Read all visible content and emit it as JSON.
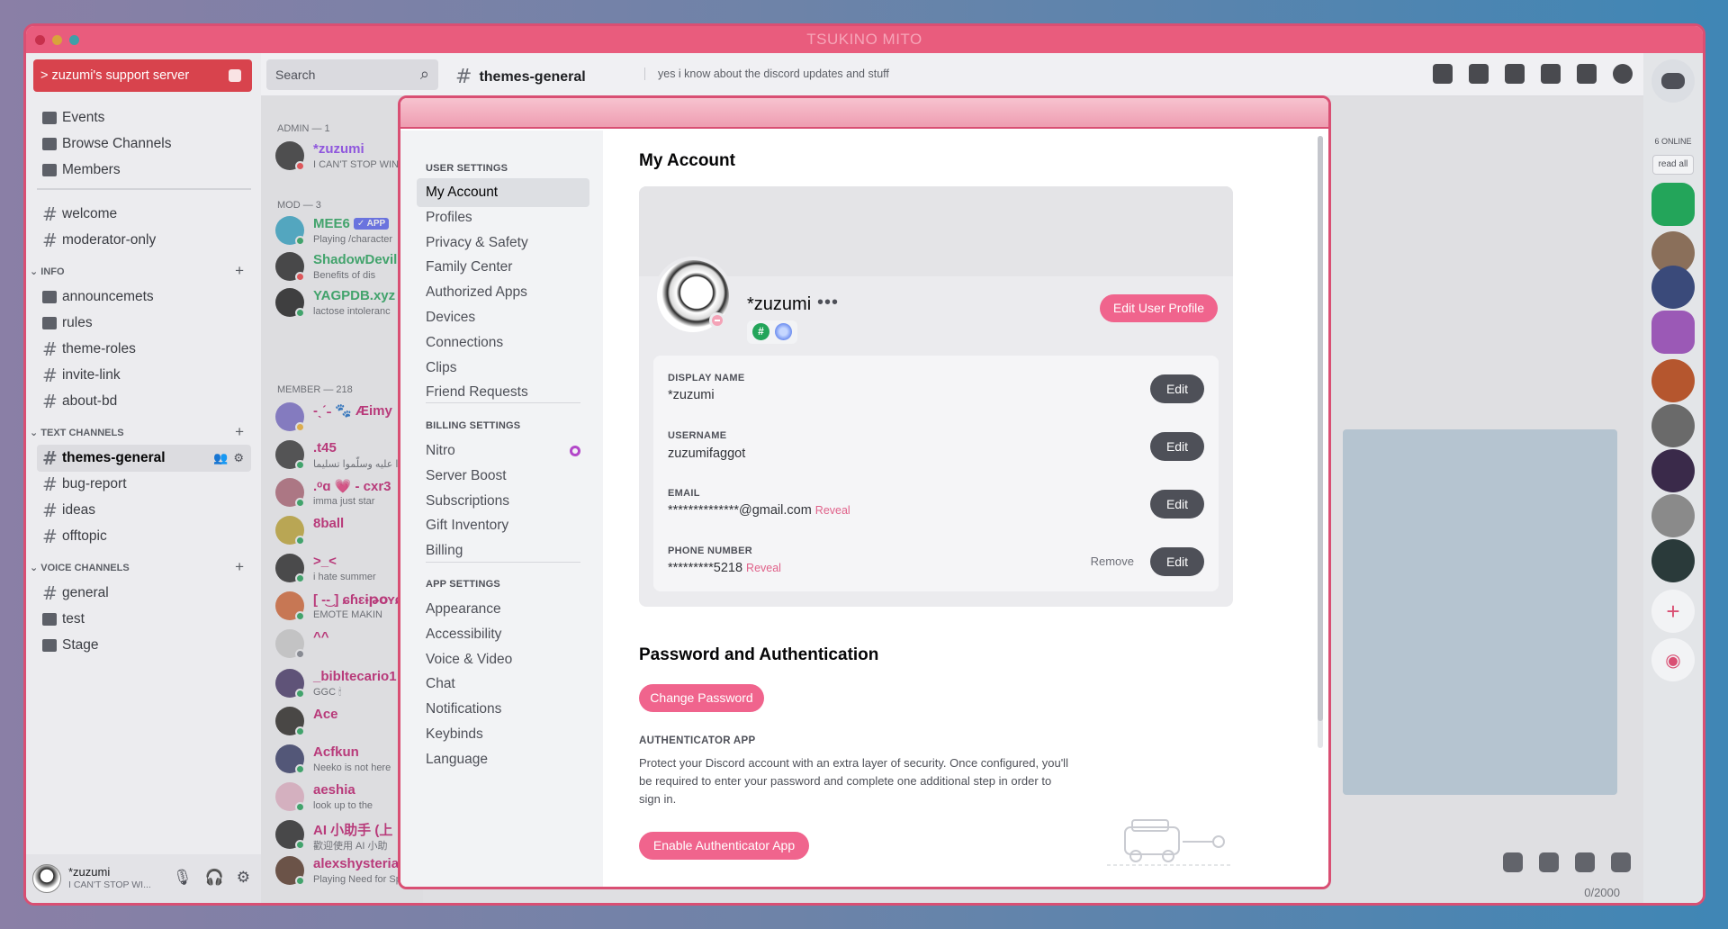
{
  "window": {
    "title": "TSUKINO MITO",
    "accent": "#e95c7d"
  },
  "server": {
    "name": "> zuzumi's support server",
    "nav": [
      {
        "label": "Events",
        "icon": "calendar-icon"
      },
      {
        "label": "Browse Channels",
        "icon": "browse-icon"
      },
      {
        "label": "Members",
        "icon": "members-icon"
      }
    ],
    "channels_top": [
      "welcome",
      "moderator-only"
    ],
    "info_category": "INFO",
    "info_channels": [
      {
        "label": "announcemets",
        "icon": "megaphone-icon"
      },
      {
        "label": "rules",
        "icon": "rules-icon"
      },
      {
        "label": "theme-roles",
        "icon": "hash-icon"
      },
      {
        "label": "invite-link",
        "icon": "hash-icon"
      },
      {
        "label": "about-bd",
        "icon": "hash-icon"
      }
    ],
    "text_category": "TEXT CHANNELS",
    "text_channels": [
      "themes-general",
      "bug-report",
      "ideas",
      "offtopic"
    ],
    "voice_category": "VOICE CHANNELS",
    "voice_channels": [
      "general",
      "test",
      "Stage"
    ]
  },
  "user_panel": {
    "name": "*zuzumi",
    "status": "I CAN'T STOP WI..."
  },
  "topbar": {
    "search_placeholder": "Search",
    "channel": "themes-general",
    "topic": "yes i know about the discord updates and stuff"
  },
  "members": {
    "admin_header": "ADMIN — 1",
    "mod_header": "MOD — 3",
    "member_header": "MEMBER — 218",
    "list": [
      {
        "name": "*zuzumi",
        "status": "I CAN'T STOP WIN",
        "color": "#8a3ff0",
        "avatar": "#333333",
        "dot": "#f23f43"
      },
      {
        "name": "MEE6",
        "status": "Playing /character",
        "color": "#23a55a",
        "avatar": "#3aa8c9",
        "dot": "#23a55a",
        "badge": "✓ APP"
      },
      {
        "name": "ShadowDevil",
        "status": "Benefits of dis",
        "color": "#23a55a",
        "avatar": "#2b2b2b",
        "dot": "#f23f43"
      },
      {
        "name": "YAGPDB.xyz",
        "status": "lactose intoleranc",
        "color": "#23a55a",
        "avatar": "#1f1f1f",
        "dot": "#23a55a"
      },
      {
        "name": "-ˎˊ˗ 🐾 Æimy",
        "status": "",
        "color": "#c0186c",
        "avatar": "#7b6fc9",
        "dot": "#f0b232"
      },
      {
        "name": ".t45",
        "status": "صلّوا عليه وسلّموا تسليما",
        "color": "#c0186c",
        "avatar": "#3b3b3b",
        "dot": "#23a55a"
      },
      {
        "name": ".ᵒɑ 💗 - cxr3",
        "status": "imma just star",
        "color": "#c0186c",
        "avatar": "#b06a7a",
        "dot": "#23a55a"
      },
      {
        "name": "8ball",
        "status": "",
        "color": "#c0186c",
        "avatar": "#c2a83a",
        "dot": "#23a55a"
      },
      {
        "name": ">_<",
        "status": "i hate summer",
        "color": "#c0186c",
        "avatar": "#2e2e2e",
        "dot": "#23a55a"
      },
      {
        "name": "[ -͜- ] ɕɦɛɨթօʏɕ",
        "status": "EMOTE MAKIN",
        "color": "#c0186c",
        "avatar": "#d46a3a",
        "dot": "#23a55a"
      },
      {
        "name": "^^",
        "status": "",
        "color": "#c0186c",
        "avatar": "#cfcfcf",
        "dot": "#80848e"
      },
      {
        "name": "_bibltecario1",
        "status": "GGC 🕯",
        "color": "#c0186c",
        "avatar": "#4a3a6a",
        "dot": "#23a55a"
      },
      {
        "name": "Ace",
        "status": "",
        "color": "#c0186c",
        "avatar": "#2d2a26",
        "dot": "#23a55a"
      },
      {
        "name": "Acfkun",
        "status": "Neeko is not here",
        "color": "#c0186c",
        "avatar": "#3a3f6a",
        "dot": "#23a55a"
      },
      {
        "name": "aeshia",
        "status": "look up to the",
        "color": "#c0186c",
        "avatar": "#e6b6c9",
        "dot": "#23a55a"
      },
      {
        "name": "AI 小助手 (上",
        "status": "歡迎使用 AI 小助",
        "color": "#c0186c",
        "avatar": "#2b2b2b",
        "dot": "#23a55a"
      },
      {
        "name": "alexshysteria",
        "status": "Playing Need for Sp",
        "color": "#c0186c",
        "avatar": "#5a3a2a",
        "dot": "#23a55a"
      }
    ]
  },
  "rail": {
    "online": "6 ONLINE",
    "read_all": "read all",
    "servers": [
      "#23a55a",
      "#8a6f5a",
      "#3a4a7a",
      "#9b59b6",
      "#b5562e",
      "#6a6a6a",
      "#3a2a4a",
      "#8a8a8a",
      "#2a3a3a"
    ]
  },
  "chat": {
    "counter": "0/2000"
  },
  "settings": {
    "user_header": "USER SETTINGS",
    "user_items": [
      "My Account",
      "Profiles",
      "Privacy & Safety",
      "Family Center",
      "Authorized Apps",
      "Devices",
      "Connections",
      "Clips",
      "Friend Requests"
    ],
    "billing_header": "BILLING SETTINGS",
    "billing_items": [
      "Nitro",
      "Server Boost",
      "Subscriptions",
      "Gift Inventory",
      "Billing"
    ],
    "app_header": "APP SETTINGS",
    "app_items": [
      "Appearance",
      "Accessibility",
      "Voice & Video",
      "Chat",
      "Notifications",
      "Keybinds",
      "Language"
    ],
    "active_item": "My Account"
  },
  "account": {
    "title": "My Account",
    "profile_name": "*zuzumi",
    "more": "•••",
    "edit_profile": "Edit User Profile",
    "fields": [
      {
        "label": "DISPLAY NAME",
        "value": "*zuzumi",
        "reveal": "",
        "button": "Edit"
      },
      {
        "label": "USERNAME",
        "value": "zuzumifaggot",
        "reveal": "",
        "button": "Edit"
      },
      {
        "label": "EMAIL",
        "value": "**************@gmail.com",
        "reveal": "Reveal",
        "button": "Edit"
      },
      {
        "label": "PHONE NUMBER",
        "value": "*********5218",
        "reveal": "Reveal",
        "button": "Edit",
        "secondary": "Remove"
      }
    ],
    "password_title": "Password and Authentication",
    "change_password": "Change Password",
    "authenticator_header": "AUTHENTICATOR APP",
    "authenticator_desc": "Protect your Discord account with an extra layer of security. Once configured, you'll be required to enter your password and complete one additional step in order to sign in.",
    "enable_authenticator": "Enable Authenticator App"
  }
}
